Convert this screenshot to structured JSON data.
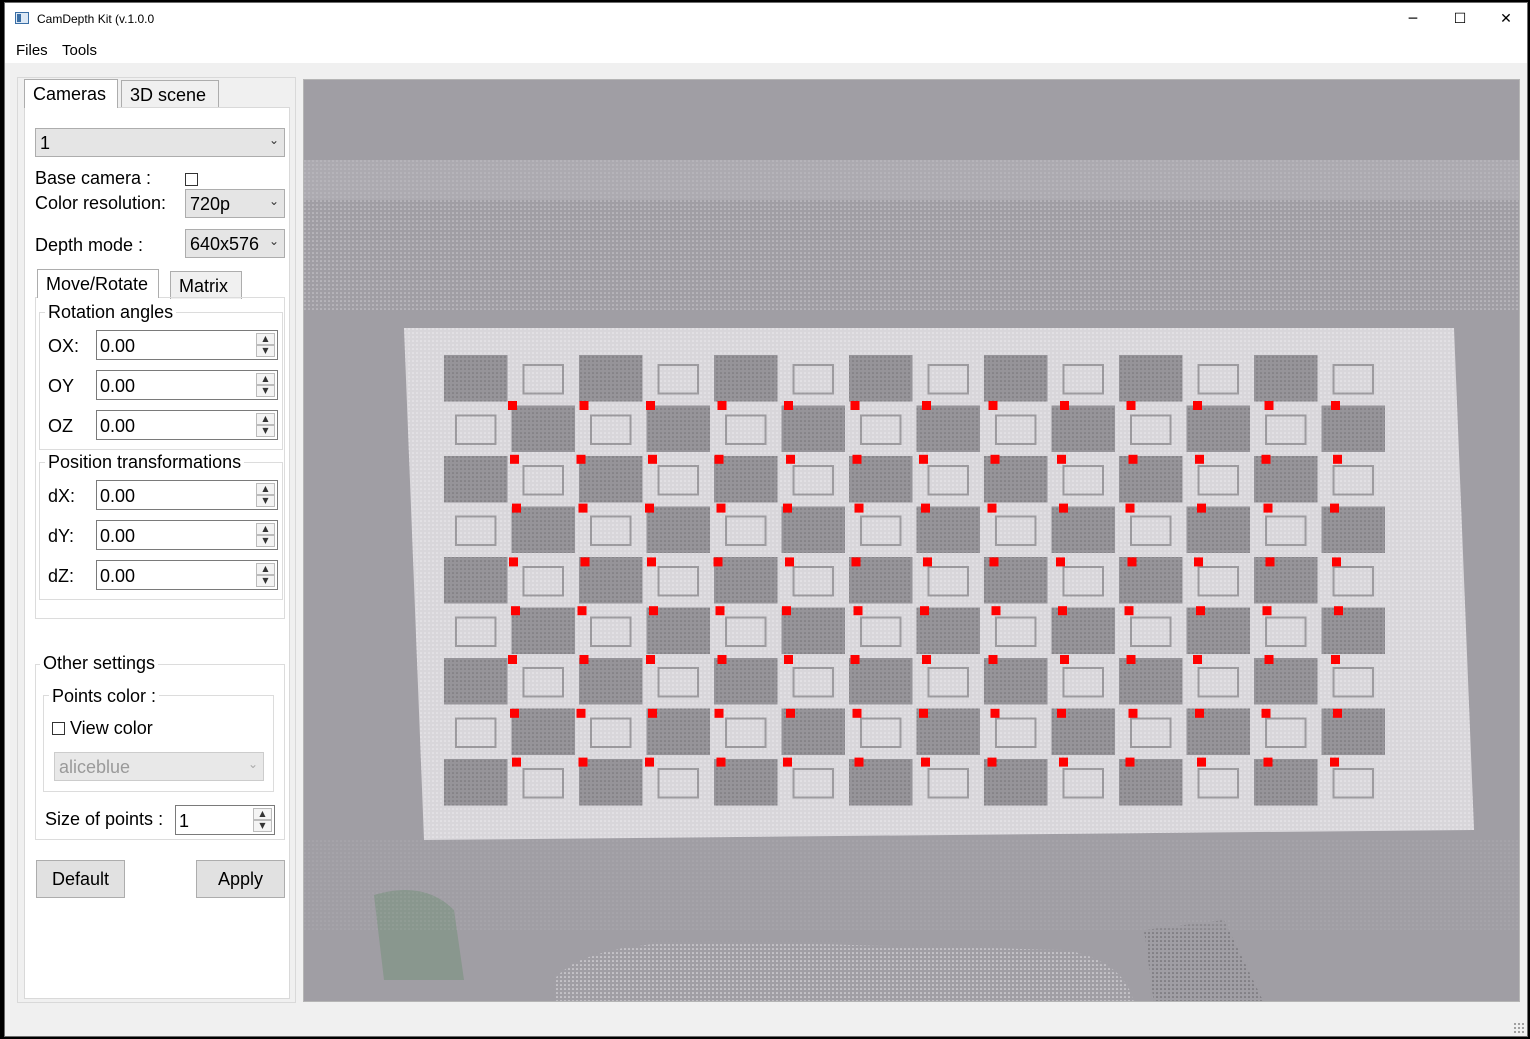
{
  "window": {
    "title": "CamDepth Kit (v.1.0.0",
    "minimize_glyph": "─",
    "maximize_glyph": "☐",
    "close_glyph": "✕"
  },
  "menu": [
    "Files",
    "Tools"
  ],
  "tabs": {
    "cameras": "Cameras",
    "scene": "3D scene"
  },
  "camera": {
    "selected": "1",
    "base_camera_label": "Base camera :",
    "base_camera_checked": false,
    "color_resolution_label": "Color resolution:",
    "color_resolution": "720p",
    "depth_mode_label": "Depth mode :",
    "depth_mode": "640x576"
  },
  "subtabs": {
    "move": "Move/Rotate",
    "matrix": "Matrix"
  },
  "rotation": {
    "title": "Rotation angles",
    "fields": [
      {
        "label": "OX:",
        "value": "0.00"
      },
      {
        "label": "OY",
        "value": "0.00"
      },
      {
        "label": "OZ",
        "value": "0.00"
      }
    ]
  },
  "position": {
    "title": "Position transformations",
    "fields": [
      {
        "label": "dX:",
        "value": "0.00"
      },
      {
        "label": "dY:",
        "value": "0.00"
      },
      {
        "label": "dZ:",
        "value": "0.00"
      }
    ]
  },
  "other": {
    "title": "Other settings",
    "points_color_title": "Points color :",
    "view_color_label": "View color",
    "view_color_checked": false,
    "color_value": "aliceblue",
    "size_label": "Size of points :",
    "size_value": "1"
  },
  "buttons": {
    "default": "Default",
    "apply": "Apply"
  },
  "viewport": {
    "background": "#a09ea4",
    "board_color": "#d8d6da",
    "square_color": "#8f8d91",
    "marker_color": "#ff0000",
    "marker_grid_rows": 8,
    "marker_grid_cols": 13
  }
}
